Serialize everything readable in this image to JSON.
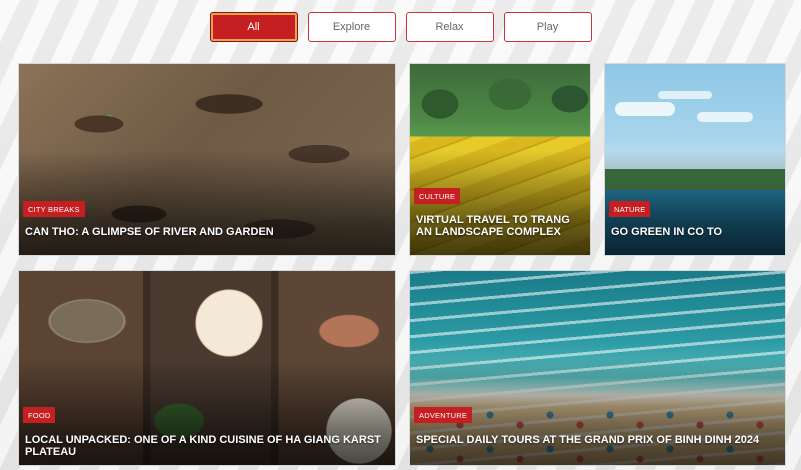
{
  "filters": [
    {
      "label": "All",
      "active": true
    },
    {
      "label": "Explore",
      "active": false
    },
    {
      "label": "Relax",
      "active": false
    },
    {
      "label": "Play",
      "active": false
    }
  ],
  "cards": [
    {
      "tag": "CITY BREAKS",
      "title": "CAN THO: A GLIMPSE OF RIVER AND GARDEN"
    },
    {
      "tag": "CULTURE",
      "title": "VIRTUAL TRAVEL TO TRANG AN LANDSCAPE COMPLEX"
    },
    {
      "tag": "NATURE",
      "title": "GO GREEN IN CO TO"
    },
    {
      "tag": "FOOD",
      "title": "LOCAL UNPACKED: ONE OF A KIND CUISINE OF HA GIANG KARST PLATEAU"
    },
    {
      "tag": "ADVENTURE",
      "title": "SPECIAL DAILY TOURS AT THE GRAND PRIX OF BINH DINH 2024"
    }
  ],
  "colors": {
    "accent": "#c51f22",
    "active_border": "#e9a44f"
  }
}
